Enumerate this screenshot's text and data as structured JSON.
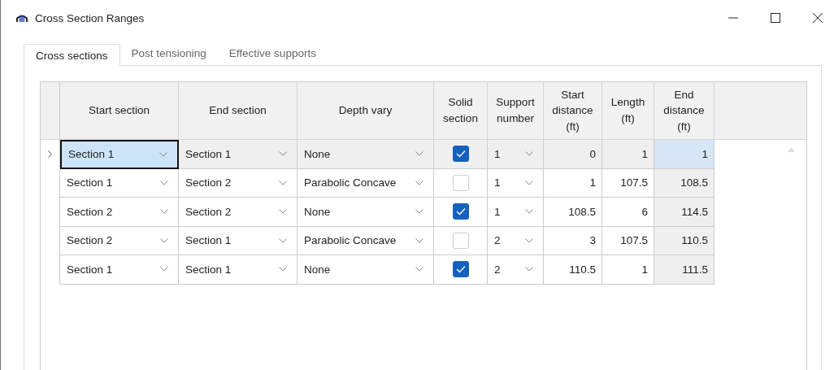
{
  "window": {
    "title": "Cross Section Ranges"
  },
  "tabs": [
    {
      "label": "Cross sections",
      "selected": true
    },
    {
      "label": "Post tensioning",
      "selected": false
    },
    {
      "label": "Effective supports",
      "selected": false
    }
  ],
  "table": {
    "columns": [
      "Start section",
      "End section",
      "Depth vary",
      "Solid section",
      "Support number",
      "Start distance (ft)",
      "Length (ft)",
      "End distance (ft)"
    ],
    "rows": [
      {
        "selected": true,
        "start_section": "Section 1",
        "end_section": "Section 1",
        "depth_vary": "None",
        "solid_section": true,
        "support_number": "1",
        "start_distance": "0",
        "length": "1",
        "end_distance": "1"
      },
      {
        "selected": false,
        "start_section": "Section 1",
        "end_section": "Section 2",
        "depth_vary": "Parabolic Concave",
        "solid_section": false,
        "support_number": "1",
        "start_distance": "1",
        "length": "107.5",
        "end_distance": "108.5"
      },
      {
        "selected": false,
        "start_section": "Section 2",
        "end_section": "Section 2",
        "depth_vary": "None",
        "solid_section": true,
        "support_number": "1",
        "start_distance": "108.5",
        "length": "6",
        "end_distance": "114.5"
      },
      {
        "selected": false,
        "start_section": "Section 2",
        "end_section": "Section 1",
        "depth_vary": "Parabolic Concave",
        "solid_section": false,
        "support_number": "2",
        "start_distance": "3",
        "length": "107.5",
        "end_distance": "110.5"
      },
      {
        "selected": false,
        "start_section": "Section 1",
        "end_section": "Section 1",
        "depth_vary": "None",
        "solid_section": true,
        "support_number": "2",
        "start_distance": "110.5",
        "length": "1",
        "end_distance": "111.5"
      }
    ]
  }
}
